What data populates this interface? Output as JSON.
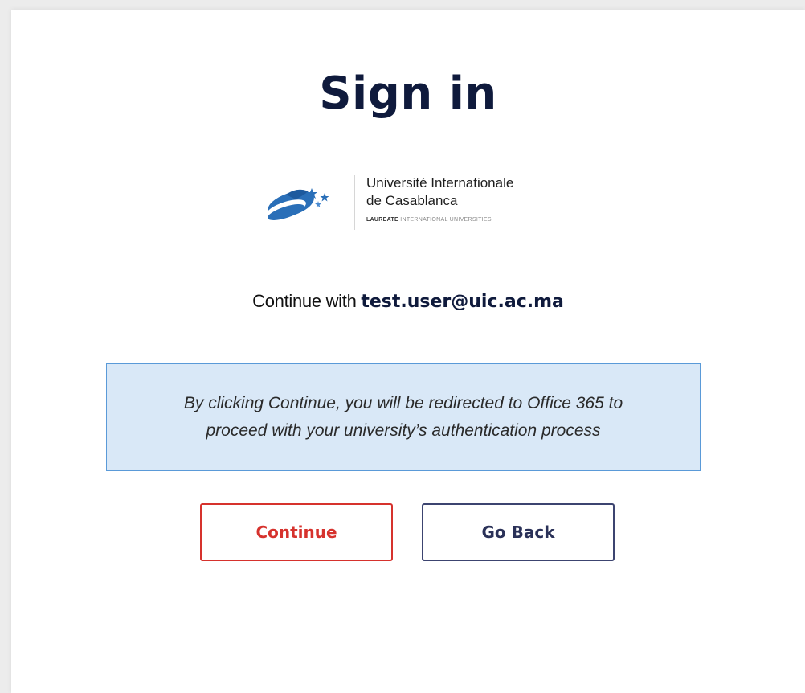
{
  "page": {
    "title": "Sign in"
  },
  "logo": {
    "name_line1": "Université Internationale",
    "name_line2": "de Casablanca",
    "tagline_bold": "LAUREATE",
    "tagline_rest": "INTERNATIONAL UNIVERSITIES",
    "icon": "globe-stars-logo-icon"
  },
  "account": {
    "prefix": "Continue with",
    "email": "test.user@uic.ac.ma"
  },
  "notice": {
    "line1": "By clicking Continue, you will be redirected to Office 365 to",
    "line2": "proceed with your university’s authentication process"
  },
  "buttons": {
    "continue_label": "Continue",
    "back_label": "Go Back"
  },
  "colors": {
    "title": "#0f1a3c",
    "continue_accent": "#d6322d",
    "back_accent": "#3c4470",
    "notice_bg": "#d9e8f7",
    "notice_border": "#5a9ad8"
  }
}
